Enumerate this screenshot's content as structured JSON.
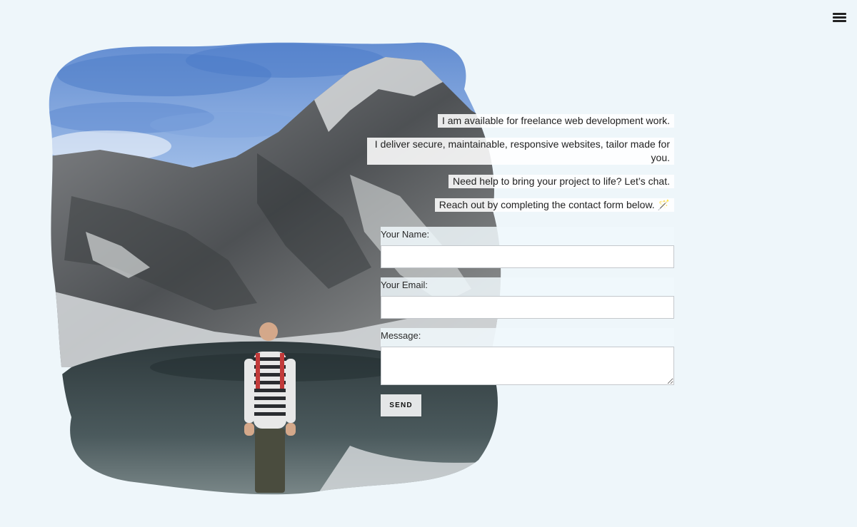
{
  "menu": {
    "icon": "hamburger-menu-icon"
  },
  "hero": {
    "image": "painted-mountain-lake-portrait",
    "sky_color": "#6f98d6",
    "rock_color": "#5a5d60",
    "lake_color": "#3c4a4e"
  },
  "intro": {
    "lines": [
      "I am available for freelance web development work.",
      "I deliver secure, maintainable, responsive websites, tailor made for you.",
      "Need help to bring your project to life? Let’s chat.",
      "Reach out by completing the contact form below. 🪄"
    ]
  },
  "form": {
    "name_label": "Your Name:",
    "name_value": "",
    "email_label": "Your Email:",
    "email_value": "",
    "message_label": "Message:",
    "message_value": "",
    "send_label": "SEND"
  }
}
